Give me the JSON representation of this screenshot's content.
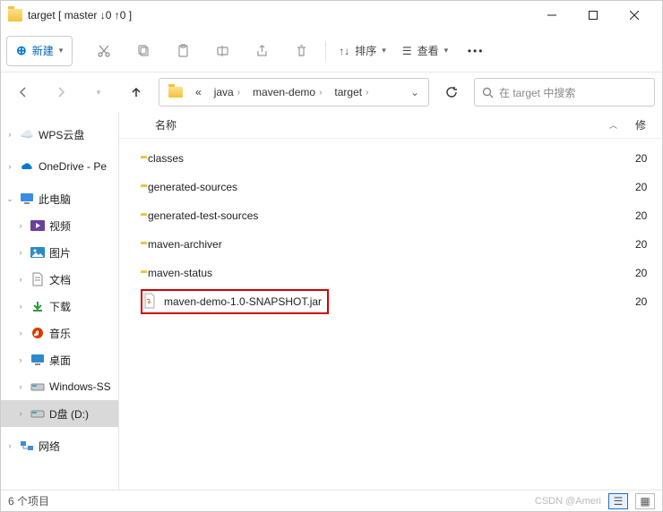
{
  "window": {
    "title": "target [ master ↓0 ↑0 ]"
  },
  "toolbar": {
    "new_label": "新建",
    "sort_label": "排序",
    "view_label": "查看"
  },
  "breadcrumbs": {
    "prefix": "«",
    "items": [
      "java",
      "maven-demo",
      "target"
    ]
  },
  "search": {
    "placeholder": "在 target 中搜索"
  },
  "columns": {
    "name": "名称",
    "modified": "修"
  },
  "sidebar": {
    "quick": [
      {
        "label": "WPS云盘",
        "icon": "wps"
      },
      {
        "label": "OneDrive - Pe",
        "icon": "onedrive"
      }
    ],
    "pc_label": "此电脑",
    "pc_children": [
      {
        "label": "视频",
        "icon": "video"
      },
      {
        "label": "图片",
        "icon": "pictures"
      },
      {
        "label": "文档",
        "icon": "documents"
      },
      {
        "label": "下载",
        "icon": "downloads"
      },
      {
        "label": "音乐",
        "icon": "music"
      },
      {
        "label": "桌面",
        "icon": "desktop"
      },
      {
        "label": "Windows-SS",
        "icon": "drive"
      }
    ],
    "selected_drive": "D盘 (D:)",
    "network": "网络"
  },
  "files": [
    {
      "name": "classes",
      "type": "folder",
      "date": "20"
    },
    {
      "name": "generated-sources",
      "type": "folder",
      "date": "20"
    },
    {
      "name": "generated-test-sources",
      "type": "folder",
      "date": "20"
    },
    {
      "name": "maven-archiver",
      "type": "folder",
      "date": "20"
    },
    {
      "name": "maven-status",
      "type": "folder",
      "date": "20"
    },
    {
      "name": "maven-demo-1.0-SNAPSHOT.jar",
      "type": "jar",
      "date": "20",
      "highlight": true
    }
  ],
  "status": {
    "count": "6 个项目",
    "watermark": "CSDN @Ameri"
  }
}
